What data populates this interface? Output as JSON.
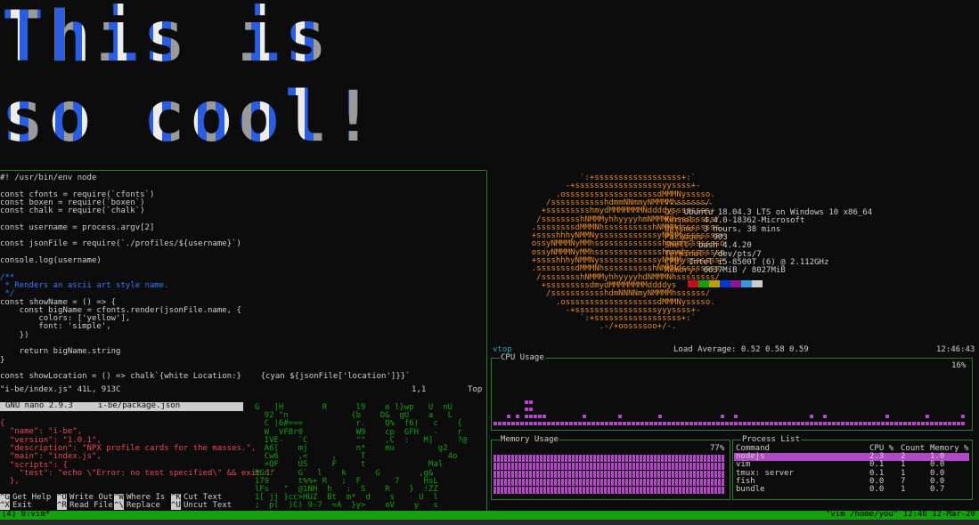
{
  "banner": {
    "line1": "This is",
    "line2": "so cool!"
  },
  "vim": {
    "lines": [
      {
        "t": "#! /usr/bin/env node",
        "c": "c-white"
      },
      {
        "t": "",
        "c": "c-white"
      },
      {
        "t": "const cfonts = require(`cfonts`)",
        "c": "c-white"
      },
      {
        "t": "const boxen = require(`boxen`)",
        "c": "c-white"
      },
      {
        "t": "const chalk = require(`chalk`)",
        "c": "c-white"
      },
      {
        "t": "",
        "c": "c-white"
      },
      {
        "t": "const username = process.argv[2]",
        "c": "c-white"
      },
      {
        "t": "",
        "c": "c-white"
      },
      {
        "t": "const jsonFile = require(`./profiles/${username}`)",
        "c": "c-white"
      },
      {
        "t": "",
        "c": "c-white"
      },
      {
        "t": "console.log(username)",
        "c": "c-white"
      },
      {
        "t": "",
        "c": "c-white"
      },
      {
        "t": "/**",
        "c": "c-blue"
      },
      {
        "t": " * Renders an ascii art style name.",
        "c": "c-blue"
      },
      {
        "t": " */",
        "c": "c-blue"
      },
      {
        "t": "const showName = () => {",
        "c": "c-white"
      },
      {
        "t": "    const bigName = cfonts.render(jsonFile.name, {",
        "c": "c-white"
      },
      {
        "t": "        colors: ['yellow'],",
        "c": "c-white"
      },
      {
        "t": "        font: 'simple',",
        "c": "c-white"
      },
      {
        "t": "    })",
        "c": "c-white"
      },
      {
        "t": "",
        "c": "c-white"
      },
      {
        "t": "    return bigName.string",
        "c": "c-white"
      },
      {
        "t": "}",
        "c": "c-white"
      },
      {
        "t": "",
        "c": "c-white"
      },
      {
        "t": "const showLocation = () => chalk`{white Location:}    {cyan ${jsonFile['location']}}`",
        "c": "c-white"
      }
    ],
    "status_left": "\"i-be/index.js\" 41L, 913C",
    "status_pos": "1,1",
    "status_right": "Top"
  },
  "nano": {
    "header_left": "GNU nano 2.9.3",
    "header_file": "i-be/package.json",
    "lines": [
      "{",
      "  \"name\": \"i-be\",",
      "  \"version\": \"1.0.1\",",
      "  \"description\": \"NPX profile cards for the masses.\",",
      "  \"main\": \"index.js\",",
      "  \"scripts\": {",
      "    \"test\": \"echo \\\"Error: no test specified\\\" && exit 1\"",
      "  },"
    ],
    "shortcuts": [
      {
        "key": "^G",
        "label": "Get Help"
      },
      {
        "key": "^O",
        "label": "Write Out"
      },
      {
        "key": "^W",
        "label": "Where Is"
      },
      {
        "key": "^K",
        "label": "Cut Text"
      },
      {
        "key": "^X",
        "label": "Exit"
      },
      {
        "key": "^R",
        "label": "Read File"
      },
      {
        "key": "^\\",
        "label": "Replace"
      },
      {
        "key": "^U",
        "label": "Uncut Text"
      }
    ]
  },
  "matrix": {
    "lines": [
      "  G   ]H        R      l9    e l}wp   U  nU",
      "    92 \"n             {b    D&  gU    a   L",
      "    C |6#===           r.    Q%  f6)   c    {",
      "    W  VFBr0           W9    cp  GFH   -    r",
      "    IVE-   `C          \"\"    ,C  :   M]     ?@",
      "    A6[    mj          n*    mu         g2",
      "    Cw6    ,<     ,     T                 4o",
      "    =QF    US     F     t             Mal",
      "  EGn:     G`  l    k      G        ,g&",
      "  179      t%%+ R   ;  F       7     HsL",
      "  lFs   \"  @1NH  h   :  S    R    }  !ZZ",
      "  1[ jj }cc>HUZ  Bt  m*  d    s     U  l",
      "  ;  p(  )C) 9-7  =A  }y>    oV    y   s"
    ]
  },
  "neofetch": {
    "art": [
      "                   `:+ssssssssssssssssss+:`",
      "                -+ssssssssssssssssssyyssss+-",
      "              .osssssssssssssssssssdMMMNysssso.",
      "            /ssssssssssshdmmNNmmyNMMMMhssssss/",
      "           +ssssssssshmydMMMMMMMNddddyssssssss+",
      "          /sssssssshNMMMyhhyyyyhmNMMMNhssssssss/",
      "         .ssssssssdMMMNhsssssssssshNMMMdssssssss.",
      "         +sssshhhyNMMNyssssssssssssyNMMMysssssss+",
      "         ossyNMMMNyMMhsssssssssssssshmmmhssssssso",
      "         ossyNMMMNyMMhsssssssssssssshmmmhssssssso",
      "         +sssshhhyNMMNyssssssssssssyNMMMysssssss+",
      "         .ssssssssdMMMNhsssssssssshNMMMdssssssss.",
      "          /sssssssshNMMMyhhyyyyhdNMMMNhssssssss/",
      "           +sssssssssdmydMMMMMMMMddddyssssssss+",
      "            /ssssssssssshdmNNNNmyNMMMMhssssss/",
      "              .osssssssssssssssssssdMMMNysssso.",
      "                -+sssssssssssssssssyyyssss+-",
      "                   `:+ssssssssssssssssss+:`",
      "                       .-/+oossssoo+/-."
    ],
    "divider": "----------",
    "info": [
      {
        "k": "OS",
        "v": "Ubuntu 18.04.3 LTS on Windows 10 x86_64"
      },
      {
        "k": "Kernel",
        "v": "4.4.0-18362-Microsoft"
      },
      {
        "k": "Uptime",
        "v": "3 hours, 38 mins"
      },
      {
        "k": "Packages",
        "v": "903"
      },
      {
        "k": "Shell",
        "v": "bash 4.4.20"
      },
      {
        "k": "Terminal",
        "v": "/dev/pts/7"
      },
      {
        "k": "CPU",
        "v": "Intel i5-8500T (6) @ 2.112GHz"
      },
      {
        "k": "Memory",
        "v": "6637MiB / 8027MiB"
      }
    ],
    "palette": [
      "#0c0c0c",
      "#c50f1f",
      "#13a10e",
      "#c19c00",
      "#0037da",
      "#881798",
      "#3a96dd",
      "#cccccc"
    ]
  },
  "vtop": {
    "title": "vtop",
    "load_label": "Load Average: 0.52 0.58 0.59",
    "clock": "12:46:43",
    "cpu_title": "CPU Usage",
    "cpu_value": "16%",
    "cpu_fraction": 0.16,
    "mem_title": "Memory Usage",
    "mem_value": "77%",
    "mem_fraction": 0.77,
    "proc_title": "Process List",
    "proc_headers": [
      "Command",
      "CPU %",
      "Count",
      "Memory %"
    ],
    "processes": [
      [
        "nodejs",
        "2.3",
        "2",
        "1.0"
      ],
      [
        "vim",
        "0.1",
        "1",
        "0.0"
      ],
      [
        "tmux: server",
        "0.1",
        "1",
        "0.0"
      ],
      [
        "fish",
        "0.0",
        "7",
        "0.0"
      ],
      [
        "bundle",
        "0.0",
        "1",
        "0.7"
      ]
    ],
    "highlight_color": "#b148c6"
  },
  "tmux": {
    "left": "[4] 0:vim*",
    "right": "\"vim /home/you\" 12:46 12-Mar-20"
  }
}
